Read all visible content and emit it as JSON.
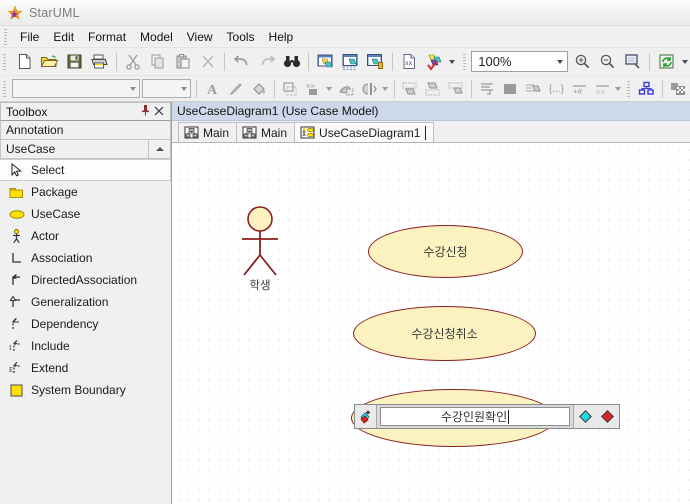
{
  "window": {
    "app_title": "StarUML",
    "logo_icon": "staruml-star-icon"
  },
  "menubar": {
    "items": [
      {
        "label": "File",
        "accel": "F"
      },
      {
        "label": "Edit",
        "accel": "E"
      },
      {
        "label": "Format",
        "accel": "o"
      },
      {
        "label": "Model",
        "accel": "M"
      },
      {
        "label": "View",
        "accel": "V"
      },
      {
        "label": "Tools",
        "accel": "T"
      },
      {
        "label": "Help",
        "accel": "H"
      }
    ]
  },
  "toolbar_main": {
    "buttons": [
      {
        "name": "new-file-button",
        "icon": "new-document-icon"
      },
      {
        "name": "open-file-button",
        "icon": "open-folder-icon"
      },
      {
        "name": "save-file-button",
        "icon": "floppy-disk-icon"
      },
      {
        "name": "print-button",
        "icon": "printer-icon"
      },
      {
        "name": "cut-button",
        "icon": "scissors-icon"
      },
      {
        "name": "copy-button",
        "icon": "copy-icon"
      },
      {
        "name": "paste-button",
        "icon": "clipboard-icon"
      },
      {
        "name": "delete-button",
        "icon": "x-delete-icon"
      },
      {
        "name": "undo-button",
        "icon": "undo-arrow-icon"
      },
      {
        "name": "redo-button",
        "icon": "redo-arrow-icon"
      },
      {
        "name": "find-button",
        "icon": "binoculars-icon"
      },
      {
        "name": "add-diagram-button",
        "icon": "diagram-add-icon"
      },
      {
        "name": "add-model-button",
        "icon": "diagram-model-icon"
      },
      {
        "name": "add-view-button",
        "icon": "diagram-view-icon"
      },
      {
        "name": "generate-report-button",
        "icon": "document-code-icon"
      },
      {
        "name": "validate-model-button",
        "icon": "validate-check-icon"
      },
      {
        "name": "refresh-button",
        "icon": "refresh-icon"
      }
    ],
    "zoom_value": "100%",
    "zoom_in": "zoom-in-icon",
    "zoom_out": "zoom-out-icon",
    "zoom_fit": "zoom-fit-icon"
  },
  "toolbar_format": {
    "font_combo_value": "",
    "size_combo_value": "",
    "buttons": [
      {
        "name": "font-color-button",
        "icon": "font-A-icon"
      },
      {
        "name": "line-color-button",
        "icon": "pen-icon"
      },
      {
        "name": "fill-color-button",
        "icon": "paint-bucket-icon"
      },
      {
        "name": "shape-style-button",
        "icon": "dashed-square-icon"
      },
      {
        "name": "stereotype-display-button",
        "icon": "quote-box-icon"
      },
      {
        "name": "align-group-button",
        "icon": "align-shape-icon"
      },
      {
        "name": "flip-button",
        "icon": "flip-icon"
      },
      {
        "name": "layer-front-button",
        "icon": "layer-front-icon"
      },
      {
        "name": "layer-back-button",
        "icon": "layer-back-icon"
      },
      {
        "name": "layer-other-button",
        "icon": "layer-other-icon"
      },
      {
        "name": "auto-layout-button",
        "icon": "auto-layout-icon"
      },
      {
        "name": "suppress-attributes-button",
        "icon": "suppress-box-icon"
      },
      {
        "name": "show-operations-button",
        "icon": "operations-icon"
      },
      {
        "name": "show-parameters-button",
        "icon": "parameters-icon"
      },
      {
        "name": "show-visibility-button",
        "icon": "visibility-icon"
      },
      {
        "name": "show-stereotype-button",
        "icon": "stereotype-icon"
      },
      {
        "name": "grid-layout-button",
        "icon": "grid-blocks-icon"
      },
      {
        "name": "checker-button",
        "icon": "checker-icon"
      }
    ]
  },
  "toolbox": {
    "title": "Toolbox",
    "pin_icon": "pin-icon",
    "close_icon": "close-x-icon",
    "groups": [
      {
        "label": "Annotation",
        "collapsed": true
      },
      {
        "label": "UseCase",
        "collapsed": false
      }
    ],
    "items": [
      {
        "label": "Select",
        "icon": "cursor-arrow-icon",
        "selected": true
      },
      {
        "label": "Package",
        "icon": "package-folder-icon",
        "selected": false
      },
      {
        "label": "UseCase",
        "icon": "ellipse-usecase-icon",
        "selected": false
      },
      {
        "label": "Actor",
        "icon": "actor-stickman-icon",
        "selected": false
      },
      {
        "label": "Association",
        "icon": "association-line-icon",
        "selected": false
      },
      {
        "label": "DirectedAssociation",
        "icon": "directed-association-icon",
        "selected": false
      },
      {
        "label": "Generalization",
        "icon": "generalization-icon",
        "selected": false
      },
      {
        "label": "Dependency",
        "icon": "dependency-icon",
        "selected": false
      },
      {
        "label": "Include",
        "icon": "include-icon",
        "selected": false
      },
      {
        "label": "Extend",
        "icon": "extend-icon",
        "selected": false
      },
      {
        "label": "System Boundary",
        "icon": "system-boundary-icon",
        "selected": false
      }
    ]
  },
  "editor": {
    "document_title": "UseCaseDiagram1 (Use Case Model)",
    "tabs": [
      {
        "label": "Main",
        "icon": "class-diagram-icon",
        "active": false
      },
      {
        "label": "Main",
        "icon": "class-diagram-icon",
        "active": false
      },
      {
        "label": "UseCaseDiagram1",
        "icon": "usecase-diagram-icon",
        "active": true
      }
    ]
  },
  "diagram": {
    "actor": {
      "label": "학생"
    },
    "usecases": [
      {
        "label": "수강신청",
        "editing": false
      },
      {
        "label": "수강신청취소",
        "editing": false
      },
      {
        "label": "수강인원확인",
        "editing": true
      }
    ],
    "inline_editor": {
      "value": "수강인원확인",
      "left_icon": "add-element-icon",
      "right_icons": [
        "cyan-diamond-icon",
        "red-diamond-icon"
      ]
    }
  },
  "colors": {
    "usecase_fill": "#fbf2bf",
    "usecase_stroke": "#8a1f1f",
    "doc_title_bar": "#cdd9ea",
    "canvas_bg": "#ffffff",
    "grid_dot": "#c9c9c9",
    "chrome_bg": "#f0f0f0"
  }
}
